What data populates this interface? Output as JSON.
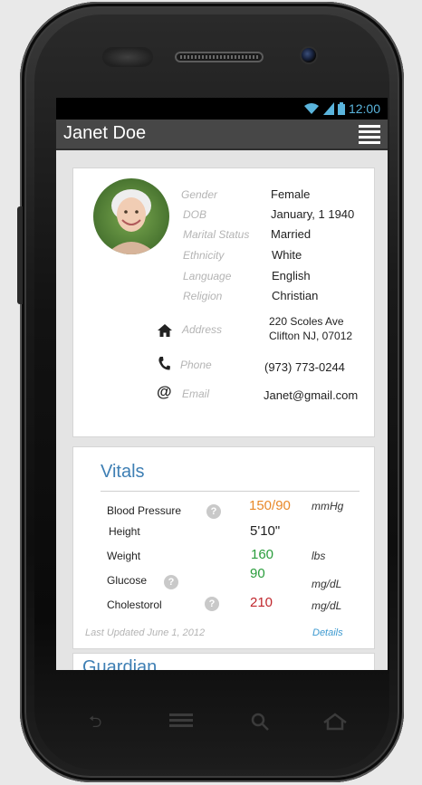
{
  "status_bar": {
    "time": "12:00",
    "wifi_icon": "wifi-icon",
    "signal_icon": "signal-icon",
    "battery_icon": "battery-icon"
  },
  "header": {
    "title": "Janet Doe",
    "menu_icon": "hamburger-menu-icon"
  },
  "profile": {
    "fields": [
      {
        "label": "Gender",
        "value": "Female"
      },
      {
        "label": "DOB",
        "value": "January, 1 1940"
      },
      {
        "label": "Marital Status",
        "value": "Married"
      },
      {
        "label": "Ethnicity",
        "value": "White"
      },
      {
        "label": "Language",
        "value": "English"
      },
      {
        "label": "Religion",
        "value": "Christian"
      }
    ],
    "address": {
      "label": "Address",
      "line1": "220 Scoles Ave",
      "line2": "Clifton NJ, 07012",
      "icon": "home-icon"
    },
    "phone": {
      "label": "Phone",
      "value": "(973) 773-0244",
      "icon": "phone-icon"
    },
    "email": {
      "label": "Email",
      "value": "Janet@gmail.com",
      "icon": "at-icon"
    }
  },
  "vitals": {
    "title": "Vitals",
    "rows": [
      {
        "label": "Blood Pressure",
        "value": "150/90",
        "unit": "mmHg",
        "color": "#e8892a",
        "help": true
      },
      {
        "label": "Height",
        "value": "5'10\"",
        "unit": "",
        "color": "#222222",
        "help": false
      },
      {
        "label": "Weight",
        "value": "160",
        "unit": "lbs",
        "color": "#2a9d3c",
        "help": false
      },
      {
        "label": "Glucose",
        "value": "90",
        "unit": "mg/dL",
        "color": "#2a9d3c",
        "help": true
      },
      {
        "label": "Cholestorol",
        "value": "210",
        "unit": "mg/dL",
        "color": "#c0272d",
        "help": true
      }
    ],
    "last_updated": "Last Updated June 1, 2012",
    "details_link": "Details",
    "help_glyph": "?"
  },
  "guardian": {
    "title": "Guardian"
  },
  "colors": {
    "accent": "#3e7fb4",
    "app_bar": "#474747"
  }
}
